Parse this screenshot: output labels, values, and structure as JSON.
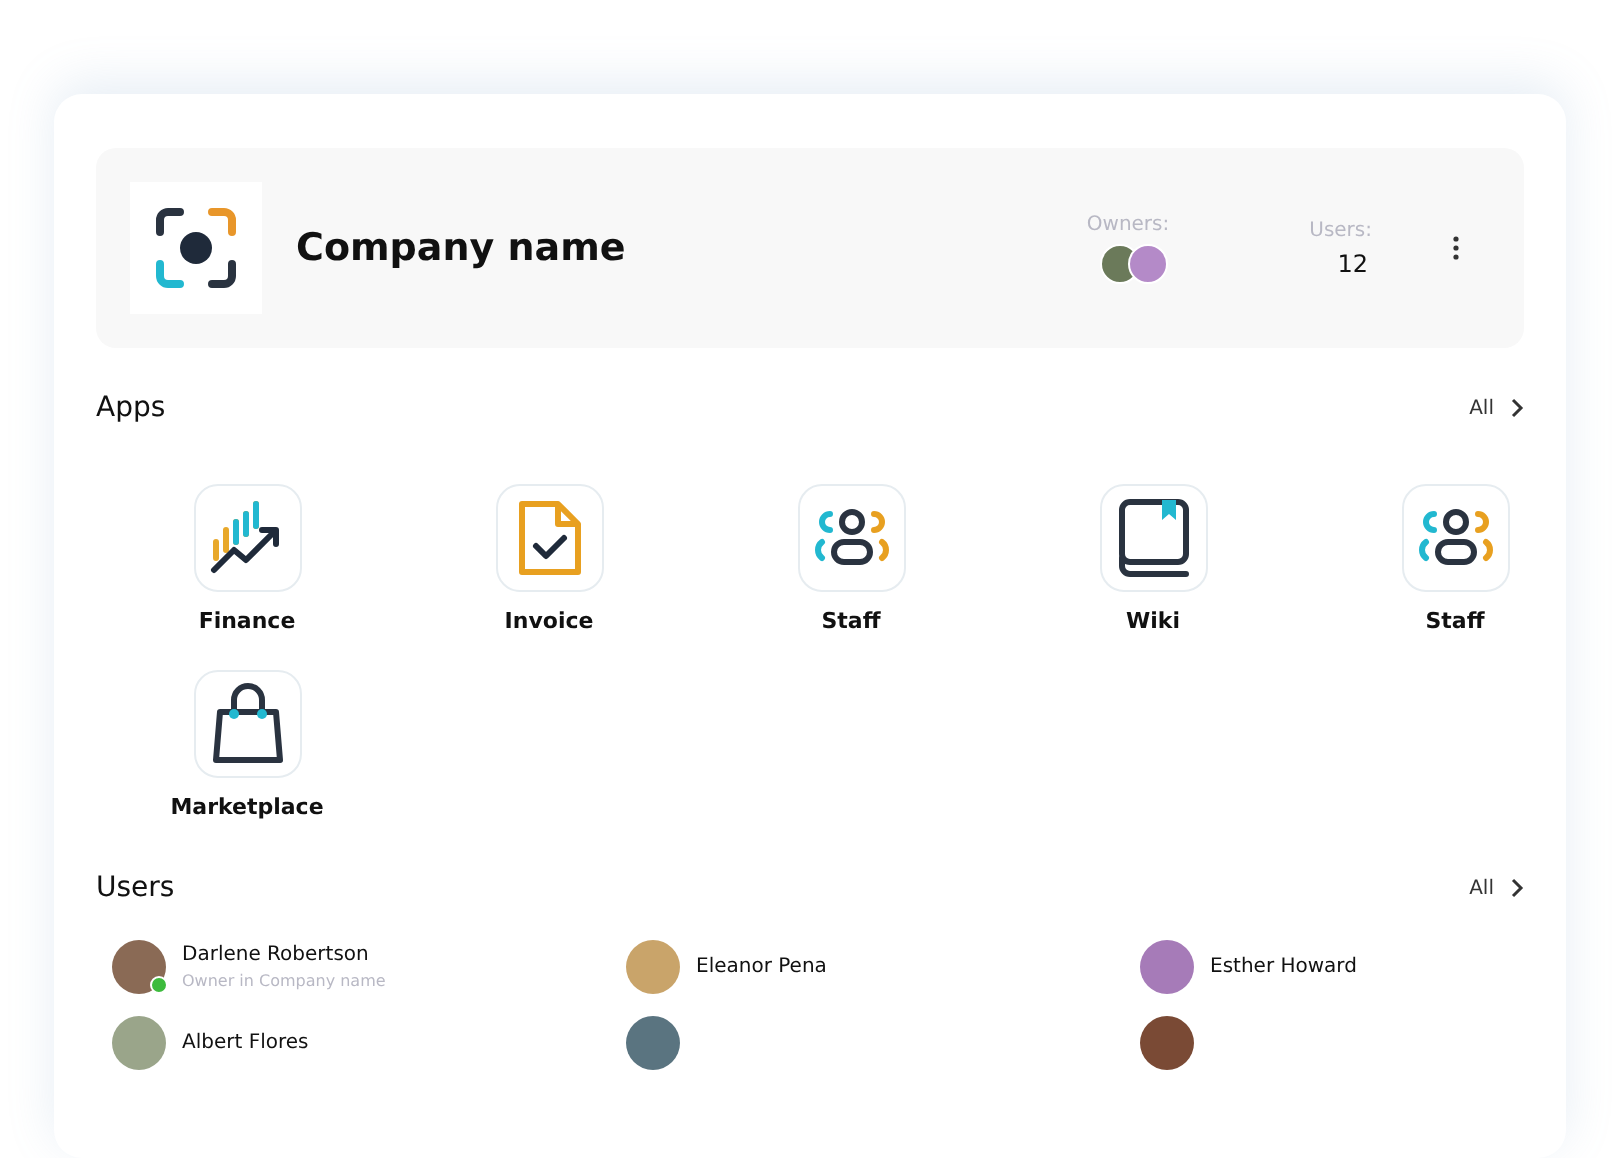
{
  "company": {
    "name": "Company name",
    "owners_label": "Owners:",
    "owners": [
      {
        "color": "#6b7a5a"
      },
      {
        "color": "#b48ac8"
      }
    ],
    "users_label": "Users:",
    "users_count": "12"
  },
  "apps": {
    "title": "Apps",
    "all": "All",
    "items": [
      {
        "label": "Finance",
        "kind": "chart"
      },
      {
        "label": "Invoice",
        "kind": "invoice"
      },
      {
        "label": "Staff",
        "kind": "people"
      },
      {
        "label": "Wiki",
        "kind": "book"
      },
      {
        "label": "Staff",
        "kind": "people"
      },
      {
        "label": "Marketplace",
        "kind": "bag"
      }
    ]
  },
  "users": {
    "title": "Users",
    "all": "All",
    "items": [
      {
        "name": "Darlene Robertson",
        "role": "Owner in Company name",
        "online": true,
        "color": "#8a6a55"
      },
      {
        "name": "Eleanor Pena",
        "online": false,
        "color": "#c9a46a"
      },
      {
        "name": "Esther Howard",
        "online": false,
        "color": "#a67bb8"
      },
      {
        "name": "Albert Flores",
        "online": false,
        "color": "#9aa58a"
      },
      {
        "online": false,
        "color": "#5a7480"
      },
      {
        "online": false,
        "color": "#7a4a35"
      }
    ]
  }
}
